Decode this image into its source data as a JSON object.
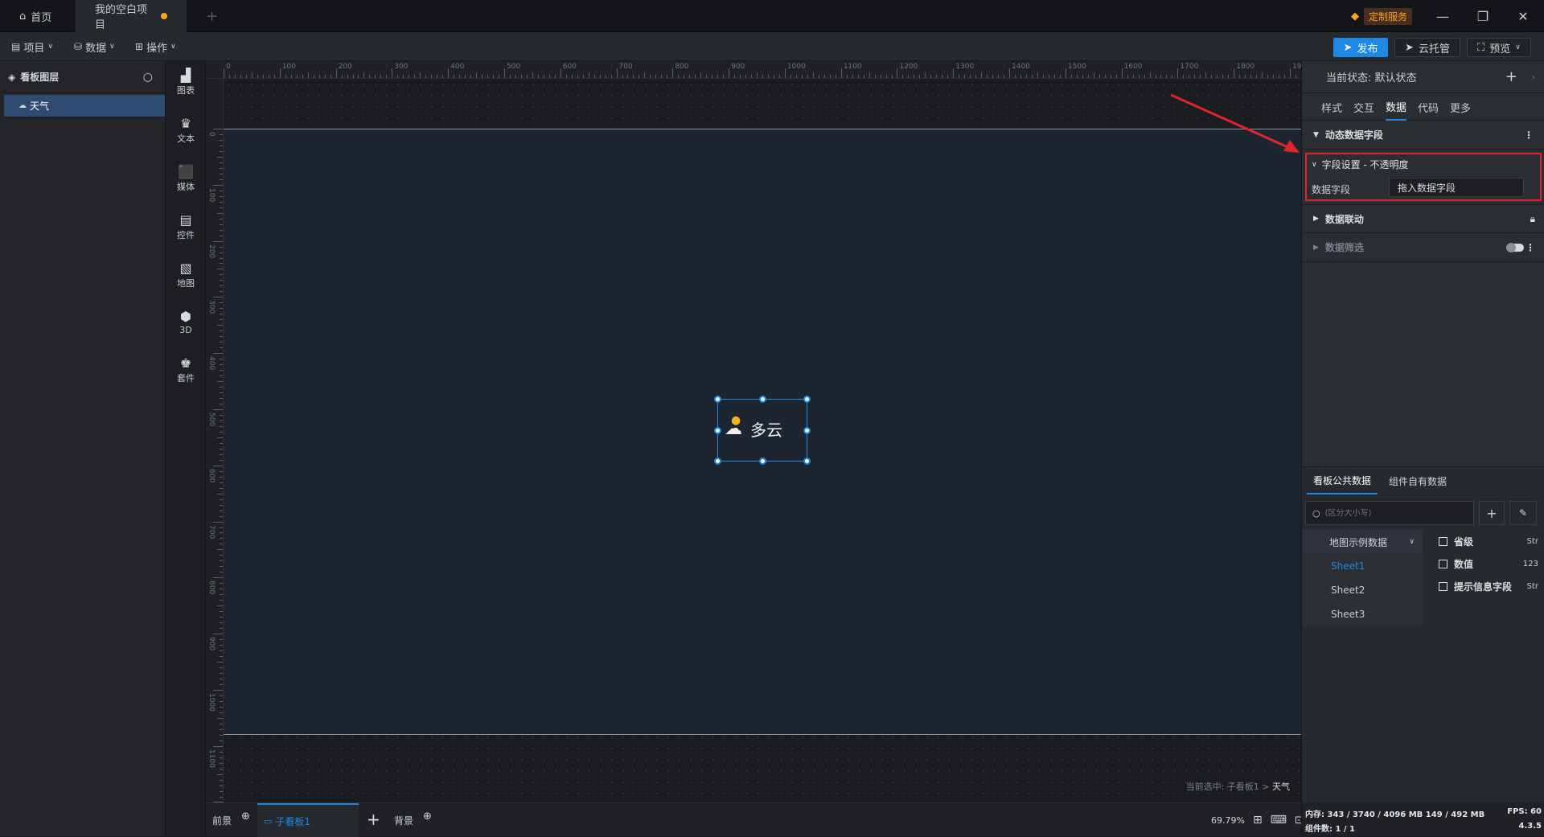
{
  "titlebar": {
    "tabs": [
      {
        "label": "首页",
        "icon": "home-icon"
      },
      {
        "label": "我的空白项目",
        "unsaved": true
      }
    ],
    "new_tab": "+",
    "custom_service": "定制服务",
    "window": {
      "minimize": "—",
      "maximize": "❐",
      "close": "✕"
    }
  },
  "menubar": {
    "menus": [
      {
        "label": "项目",
        "icon": "file-icon"
      },
      {
        "label": "数据",
        "icon": "database-icon"
      },
      {
        "label": "操作",
        "icon": "grid-icon"
      }
    ],
    "publish": "发布",
    "cloud_host": "云托管",
    "preview": "预览"
  },
  "layers": {
    "title": "看板图层",
    "items": [
      {
        "label": "天气",
        "selected": true
      }
    ]
  },
  "component_bar": [
    {
      "label": "图表",
      "icon": "chart-icon"
    },
    {
      "label": "文本",
      "icon": "text-icon"
    },
    {
      "label": "媒体",
      "icon": "media-icon"
    },
    {
      "label": "控件",
      "icon": "control-icon"
    },
    {
      "label": "地图",
      "icon": "map-icon"
    },
    {
      "label": "3D",
      "icon": "cube-icon"
    },
    {
      "label": "套件",
      "icon": "kit-icon"
    }
  ],
  "ruler": {
    "top": [
      "0",
      "100",
      "200",
      "300",
      "400",
      "500",
      "600",
      "700",
      "800",
      "900",
      "1000",
      "1100",
      "1200",
      "1300",
      "1400",
      "1500",
      "1600",
      "1700",
      "1800",
      "1900"
    ],
    "left": [
      "0",
      "100",
      "200",
      "300",
      "400",
      "500",
      "600",
      "700",
      "800",
      "900",
      "1000",
      "1100",
      "1200"
    ]
  },
  "canvas": {
    "widget_text": "多云",
    "selection_path": {
      "prefix": "当前选中: 子看板1 > ",
      "target": "天气"
    }
  },
  "bottombar": {
    "foreground": "前景",
    "subboard": "子看板1",
    "add": "+",
    "background": "背景",
    "zoom": "69.79%"
  },
  "rightpanel": {
    "state_label": "当前状态: 默认状态",
    "tabs": [
      "样式",
      "交互",
      "数据",
      "代码",
      "更多"
    ],
    "active_tab": 2,
    "sections": {
      "dynamic_fields": "动态数据字段",
      "field_settings": "字段设置 - 不透明度",
      "data_field_label": "数据字段",
      "data_field_placeholder": "拖入数据字段",
      "data_linkage": "数据联动",
      "data_filter": "数据筛选"
    },
    "data_tabs": [
      "看板公共数据",
      "组件自有数据"
    ],
    "search_placeholder": "(区分大小写)",
    "dataset": "地图示例数据",
    "sheets": [
      "Sheet1",
      "Sheet2",
      "Sheet3"
    ],
    "active_sheet": 0,
    "fields": [
      {
        "name": "省级",
        "type": "Str"
      },
      {
        "name": "数值",
        "type": "123"
      },
      {
        "name": "提示信息字段",
        "type": "Str"
      }
    ],
    "status": {
      "memory": "内存: 343 / 3740 / 4096 MB  149 / 492 MB",
      "fps": "FPS: 60",
      "components": "组件数: 1 / 1",
      "version": "4.3.5"
    }
  },
  "colors": {
    "accent": "#1e88e5",
    "highlight": "#e0242a",
    "board": "#1c2530"
  }
}
